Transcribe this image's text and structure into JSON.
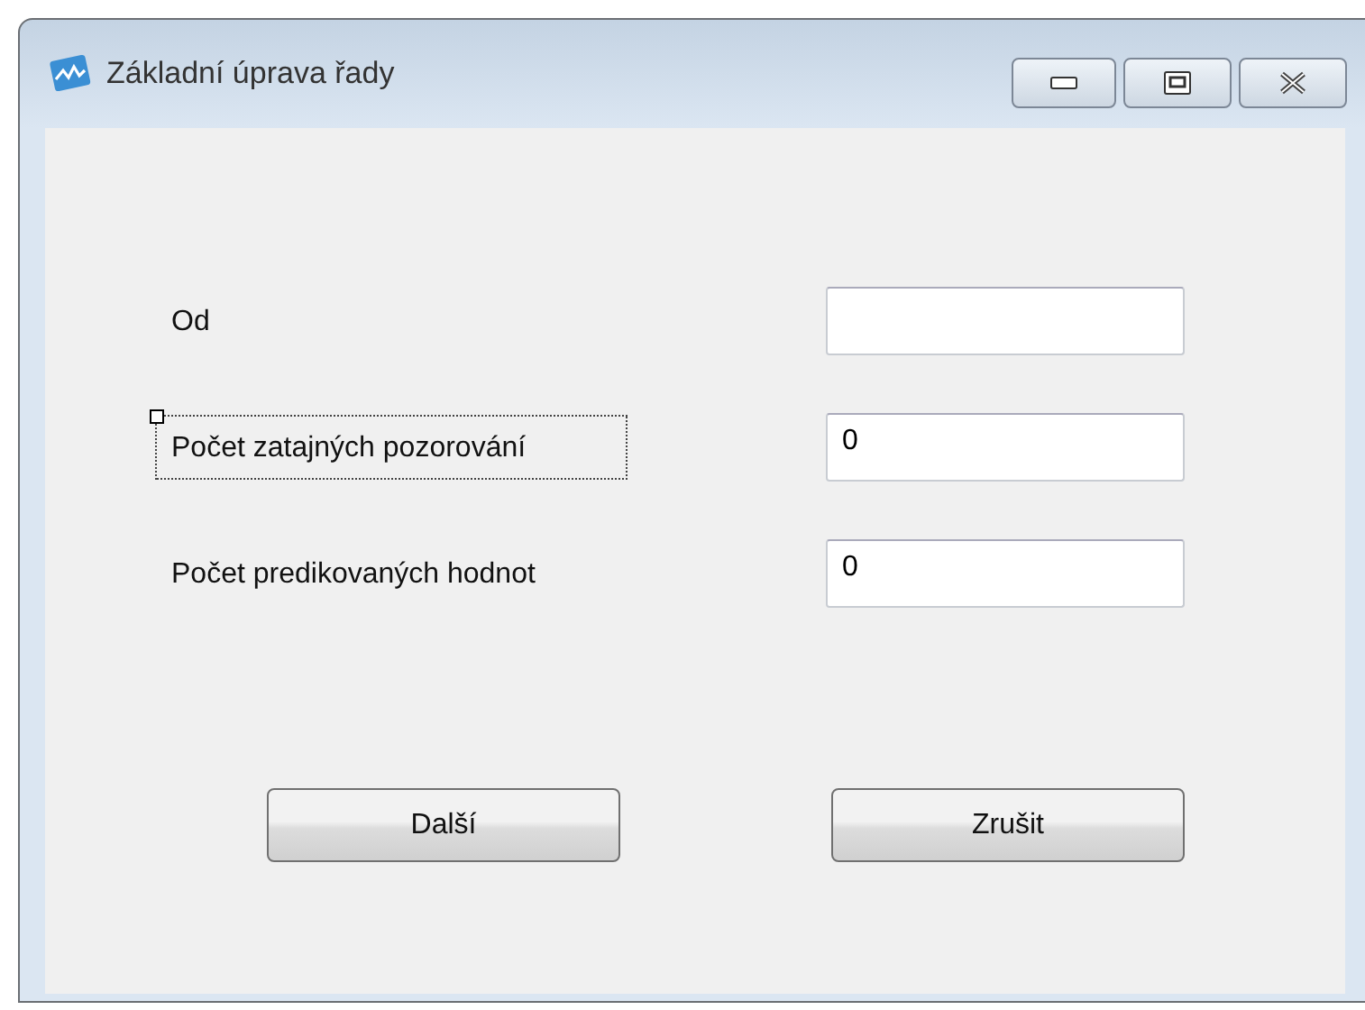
{
  "window": {
    "title": "Základní úprava řady"
  },
  "fields": [
    {
      "label": "Od",
      "focused": false
    },
    {
      "label": "Počet zatajných pozorování",
      "value": "0",
      "focused": true
    },
    {
      "label": "Počet predikovaných hodnot",
      "value": "0",
      "focused": false
    }
  ],
  "buttons": [
    "Další",
    "Zrušit"
  ]
}
